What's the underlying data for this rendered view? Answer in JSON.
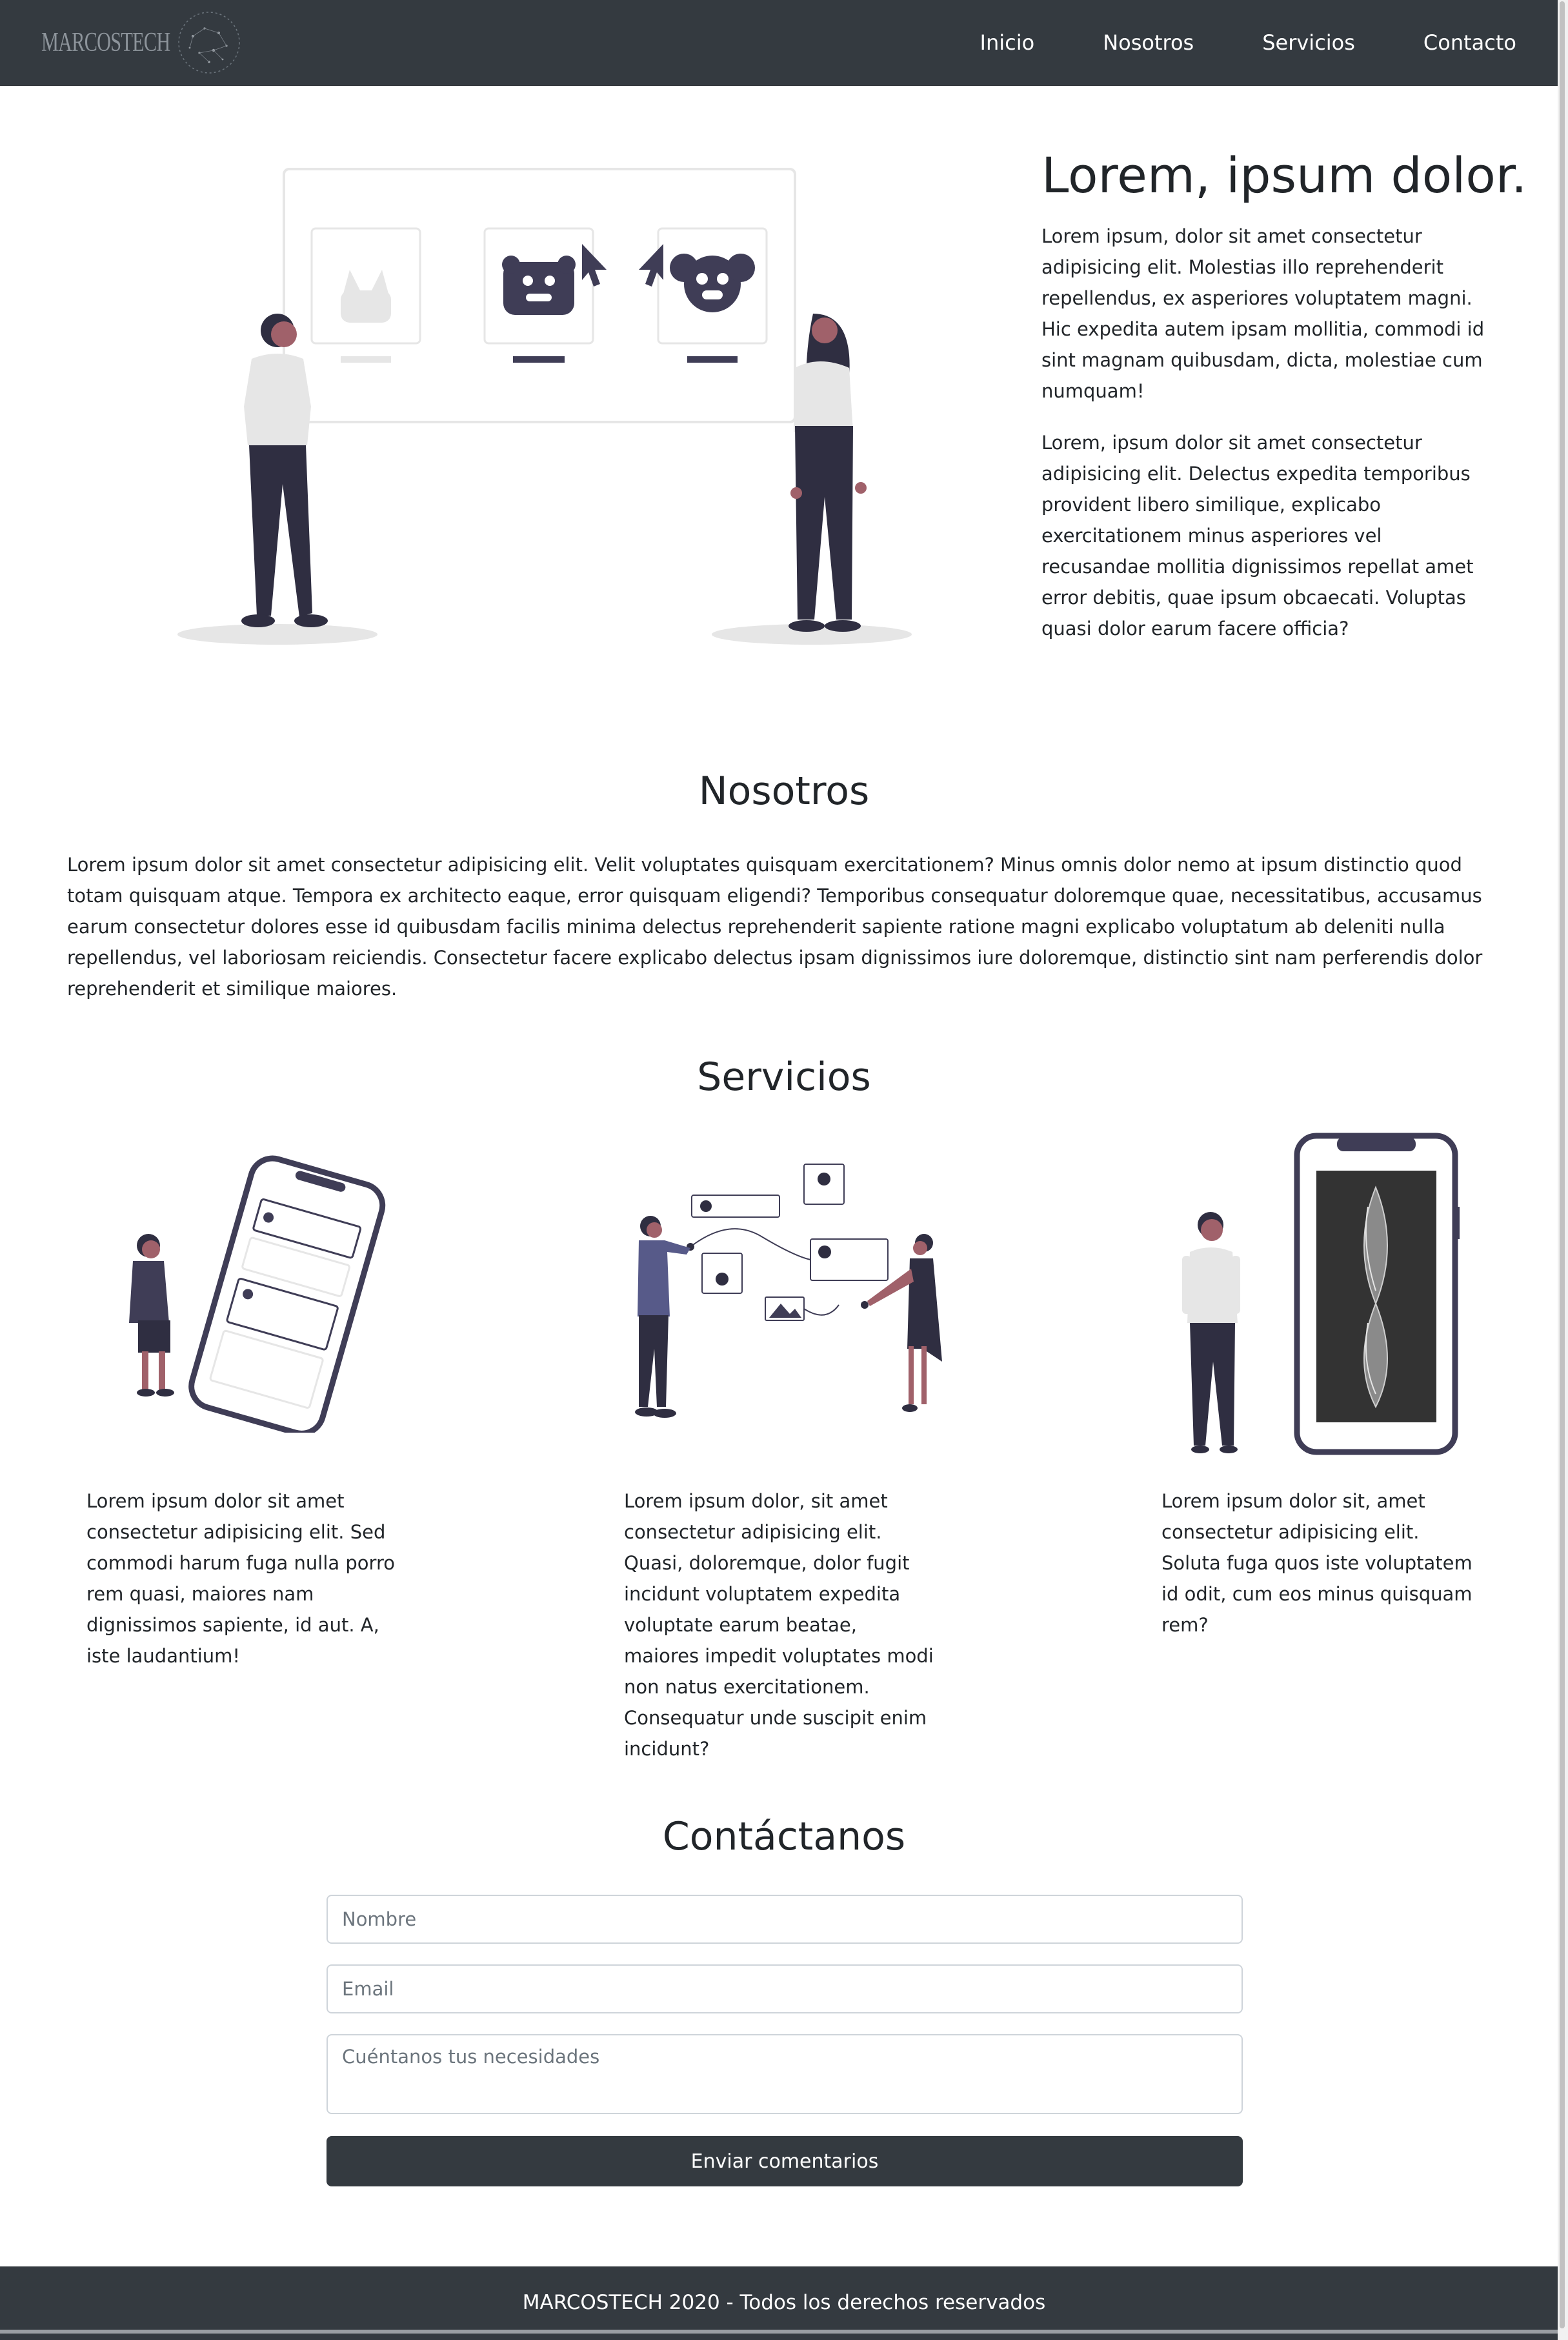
{
  "navbar": {
    "brand": "MARCOSTECH",
    "links": [
      "Inicio",
      "Nosotros",
      "Servicios",
      "Contacto"
    ]
  },
  "hero": {
    "title": "Lorem, ipsum dolor.",
    "paragraphs": [
      "Lorem ipsum, dolor sit amet consectetur adipisicing elit. Molestias illo reprehenderit repellendus, ex asperiores voluptatem magni. Hic expedita autem ipsam mollitia, commodi id sint magnam quibusdam, dicta, molestiae cum numquam!",
      "Lorem, ipsum dolor sit amet consectetur adipisicing elit. Delectus expedita temporibus provident libero similique, explicabo exercitationem minus asperiores vel recusandae mollitia dignissimos repellat amet error debitis, quae ipsum obcaecati. Voluptas quasi dolor earum facere officia?"
    ]
  },
  "nosotros": {
    "title": "Nosotros",
    "text": "Lorem ipsum dolor sit amet consectetur adipisicing elit. Velit voluptates quisquam exercitationem? Minus omnis dolor nemo at ipsum distinctio quod totam quisquam atque. Tempora ex architecto eaque, error quisquam eligendi? Temporibus consequatur doloremque quae, necessitatibus, accusamus earum consectetur dolores esse id quibusdam facilis minima delectus reprehenderit sapiente ratione magni explicabo voluptatum ab deleniti nulla repellendus, vel laboriosam reiciendis. Consectetur facere explicabo delectus ipsam dignissimos iure doloremque, distinctio sint nam perferendis dolor reprehenderit et similique maiores."
  },
  "servicios": {
    "title": "Servicios",
    "items": [
      {
        "text": "Lorem ipsum dolor sit amet consectetur adipisicing elit. Sed commodi harum fuga nulla porro rem quasi, maiores nam dignissimos sapiente, id aut. A, iste laudantium!"
      },
      {
        "text": "Lorem ipsum dolor, sit amet consectetur adipisicing elit. Quasi, doloremque, dolor fugit incidunt voluptatem expedita voluptate earum beatae, maiores impedit voluptates modi non natus exercitationem. Consequatur unde suscipit enim incidunt?"
      },
      {
        "text": "Lorem ipsum dolor sit, amet consectetur adipisicing elit. Soluta fuga quos iste voluptatem id odit, cum eos minus quisquam rem?"
      }
    ]
  },
  "contact": {
    "title": "Contáctanos",
    "name_placeholder": "Nombre",
    "email_placeholder": "Email",
    "message_placeholder": "Cuéntanos tus necesidades",
    "submit_label": "Enviar comentarios"
  },
  "footer": {
    "text": "MARCOSTECH 2020 - Todos los derechos reservados"
  },
  "colors": {
    "navbar_bg": "#343a40",
    "illustration_dark": "#2f2e41",
    "illustration_light": "#e6e6e6"
  }
}
